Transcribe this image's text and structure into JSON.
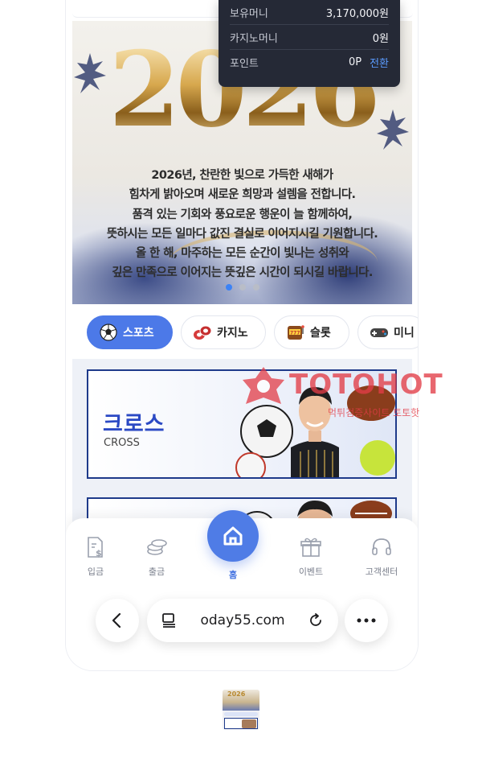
{
  "balance": {
    "rows": [
      {
        "label": "보유머니",
        "value": "3,170,000원"
      },
      {
        "label": "카지노머니",
        "value": "0원"
      },
      {
        "label": "포인트",
        "value": "0P",
        "action": "전환"
      }
    ]
  },
  "banner": {
    "year": "2026",
    "lines": [
      "2026년, 찬란한 빛으로 가득한 새해가",
      "힘차게 밝아오며 새로운 희망과 설렘을 전합니다.",
      "품격 있는 기회와 풍요로운 행운이 늘 함께하여,",
      "뜻하시는 모든 일마다 값진 결실로 이어지시길 기원합니다.",
      "올 한 해, 마주하는 모든 순간이 빛나는 성취와",
      "깊은 만족으로 이어지는 뜻깊은 시간이 되시길 바랍니다."
    ],
    "slide_count": 3,
    "active_slide": 1
  },
  "tabs": [
    {
      "label": "스포츠",
      "icon": "soccer-ball-icon",
      "active": true
    },
    {
      "label": "카지노",
      "icon": "casino-chips-icon",
      "active": false
    },
    {
      "label": "슬롯",
      "icon": "slot-machine-icon",
      "active": false
    },
    {
      "label": "미니",
      "icon": "gamepad-icon",
      "active": false
    }
  ],
  "cards": [
    {
      "title_kr": "크로스",
      "title_en": "CROSS"
    }
  ],
  "watermark": {
    "brand": "TOTOHOT",
    "sub": "먹튀검증사이트 토토핫"
  },
  "bottom_nav": {
    "deposit": "입금",
    "withdraw": "출금",
    "home": "홈",
    "event": "이벤트",
    "support": "고객센터"
  },
  "browser": {
    "url": "oday55.com"
  },
  "colors": {
    "accent": "#4f7ce6",
    "active_tab": "#4c79e8",
    "popup_bg": "#252936",
    "card_border": "#1e3a8a",
    "convert_link": "#5b9cff"
  }
}
